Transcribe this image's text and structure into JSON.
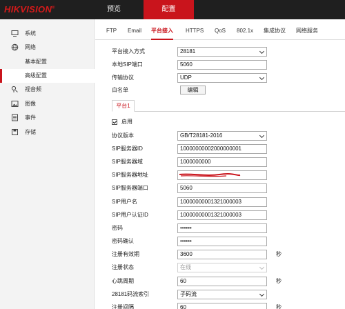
{
  "header": {
    "logo": "HIKVISION",
    "logo_mark": "®",
    "nav": [
      {
        "label": "预览",
        "active": false
      },
      {
        "label": "配置",
        "active": true
      }
    ],
    "accent_color": "#c9141c"
  },
  "sidebar": {
    "items": [
      {
        "label": "系统",
        "icon": "monitor-icon"
      },
      {
        "label": "网络",
        "icon": "globe-icon"
      },
      {
        "label": "基本配置",
        "sub": true,
        "active": false
      },
      {
        "label": "高级配置",
        "sub": true,
        "active": true
      },
      {
        "label": "视音频",
        "icon": "audio-video-icon"
      },
      {
        "label": "图像",
        "icon": "image-icon"
      },
      {
        "label": "事件",
        "icon": "event-icon"
      },
      {
        "label": "存储",
        "icon": "storage-icon"
      }
    ]
  },
  "tabs": [
    "FTP",
    "Email",
    "平台接入",
    "HTTPS",
    "QoS",
    "802.1x",
    "集成协议",
    "网络服务"
  ],
  "active_tab": "平台接入",
  "top_form": {
    "access_mode_label": "平台接入方式",
    "access_mode_value": "28181",
    "local_sip_port_label": "本地SIP端口",
    "local_sip_port_value": "5060",
    "transport_label": "传输协议",
    "transport_value": "UDP",
    "whitelist_label": "白名单",
    "edit_button": "编辑"
  },
  "platform_tab": "平台1",
  "enable_label": "启用",
  "enable_checked": true,
  "platform_form": {
    "protocol_version_label": "协议版本",
    "protocol_version_value": "GB/T28181-2016",
    "sip_server_id_label": "SIP服务器ID",
    "sip_server_id_value": "10000000002000000001",
    "sip_server_domain_label": "SIP服务器域",
    "sip_server_domain_value": "1000000000",
    "sip_server_addr_label": "SIP服务器地址",
    "sip_server_port_label": "SIP服务器端口",
    "sip_server_port_value": "5060",
    "sip_username_label": "SIP用户名",
    "sip_username_value": "10000000001321000003",
    "sip_auth_id_label": "SIP用户认证ID",
    "sip_auth_id_value": "10000000001321000003",
    "password_label": "密码",
    "password_value": "••••••",
    "password_confirm_label": "密码确认",
    "password_confirm_value": "••••••",
    "reg_validity_label": "注册有效期",
    "reg_validity_value": "3600",
    "reg_validity_unit": "秒",
    "reg_status_label": "注册状态",
    "reg_status_value": "在线",
    "heartbeat_label": "心跳周期",
    "heartbeat_value": "60",
    "heartbeat_unit": "秒",
    "stream_index_label": "28181码流索引",
    "stream_index_value": "子码流",
    "last_label": "注册间隔",
    "last_value": "60",
    "last_unit": "秒"
  }
}
